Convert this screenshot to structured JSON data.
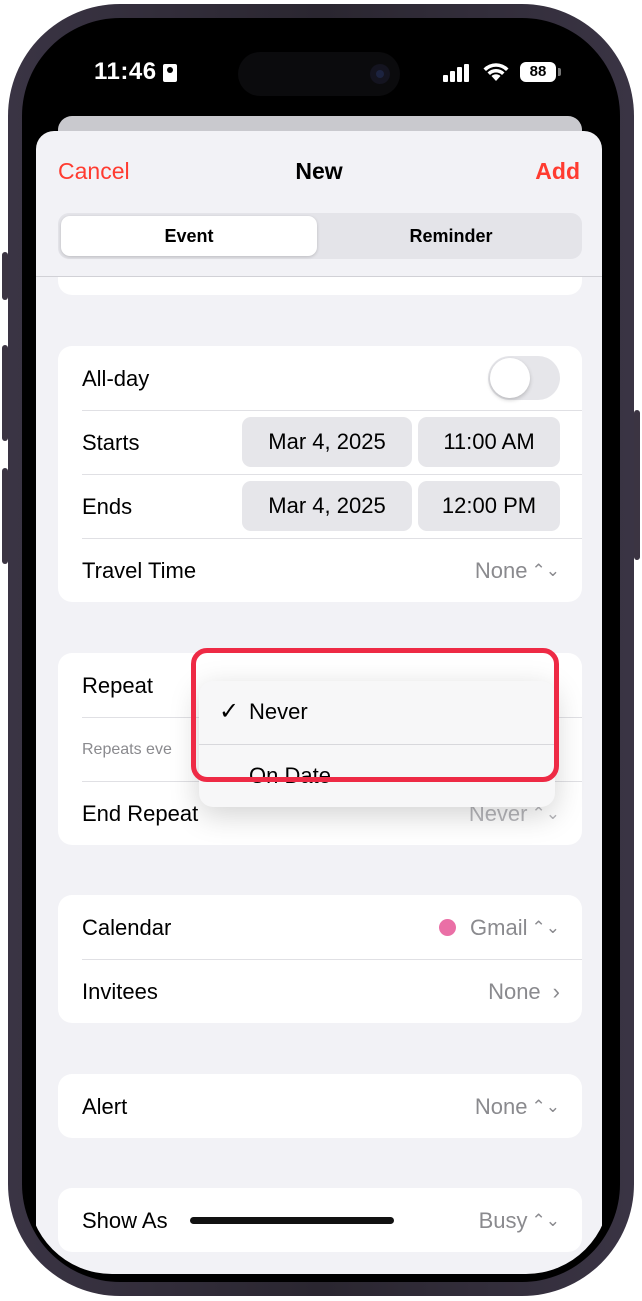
{
  "status_bar": {
    "time": "11:46",
    "battery": "88"
  },
  "nav": {
    "cancel": "Cancel",
    "title": "New",
    "add": "Add"
  },
  "segment": {
    "event": "Event",
    "reminder": "Reminder"
  },
  "datetime": {
    "allday_label": "All-day",
    "starts_label": "Starts",
    "starts_date": "Mar 4, 2025",
    "starts_time": "11:00 AM",
    "ends_label": "Ends",
    "ends_date": "Mar 4, 2025",
    "ends_time": "12:00 PM",
    "travel_label": "Travel Time",
    "travel_value": "None"
  },
  "repeat": {
    "repeat_label": "Repeat",
    "repeats_every_text": "Repeats eve",
    "end_repeat_label": "End Repeat",
    "end_repeat_value": "Never"
  },
  "menu": {
    "never": "Never",
    "on_date": "On Date"
  },
  "calendar": {
    "calendar_label": "Calendar",
    "calendar_value": "Gmail",
    "calendar_color": "#ea6fa6",
    "invitees_label": "Invitees",
    "invitees_value": "None"
  },
  "alert": {
    "alert_label": "Alert",
    "alert_value": "None"
  },
  "show_as": {
    "label": "Show As",
    "value": "Busy"
  },
  "colors": {
    "accent": "#ff3b30",
    "highlight": "#ee2a45"
  }
}
